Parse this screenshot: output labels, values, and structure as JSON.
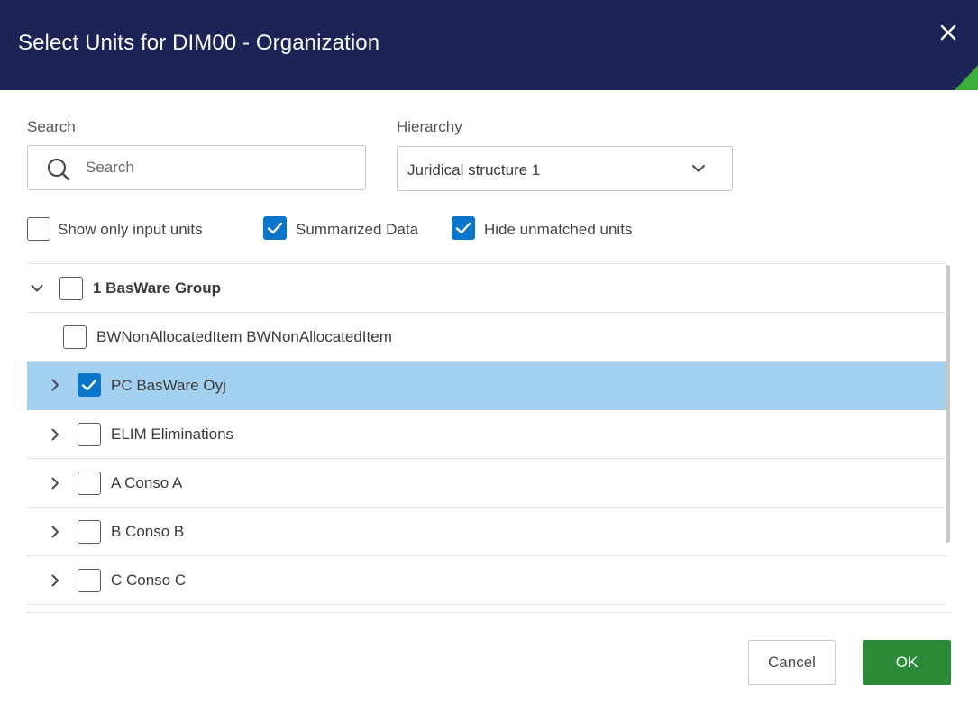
{
  "dialog": {
    "title": "Select Units for DIM00 - Organization",
    "colors": {
      "header_bg": "#1c2457",
      "accent": "#0a75c9",
      "selected_row": "#a3d0ef",
      "ok_button": "#2a8a38",
      "corner_mark": "#3cae3c"
    }
  },
  "search": {
    "label": "Search",
    "placeholder": "Search",
    "value": ""
  },
  "hierarchy": {
    "label": "Hierarchy",
    "selected": "Juridical structure 1"
  },
  "options": {
    "show_only_input_units": {
      "label": "Show only input units",
      "checked": false
    },
    "summarized_data": {
      "label": "Summarized Data",
      "checked": true
    },
    "hide_unmatched_units": {
      "label": "Hide unmatched units",
      "checked": true
    }
  },
  "tree": {
    "rows": [
      {
        "label": "1 BasWare Group",
        "expanded": true,
        "checked": false,
        "selected": false,
        "bold": true
      },
      {
        "label": "BWNonAllocatedItem BWNonAllocatedItem",
        "expanded": null,
        "checked": false,
        "selected": false,
        "bold": false
      },
      {
        "label": "PC BasWare Oyj",
        "expanded": false,
        "checked": true,
        "selected": true,
        "bold": false
      },
      {
        "label": "ELIM Eliminations",
        "expanded": false,
        "checked": false,
        "selected": false,
        "bold": false
      },
      {
        "label": "A Conso A",
        "expanded": false,
        "checked": false,
        "selected": false,
        "bold": false
      },
      {
        "label": "B Conso B",
        "expanded": false,
        "checked": false,
        "selected": false,
        "bold": false
      },
      {
        "label": "C Conso C",
        "expanded": false,
        "checked": false,
        "selected": false,
        "bold": false
      }
    ]
  },
  "buttons": {
    "cancel": "Cancel",
    "ok": "OK"
  },
  "icons": {
    "close": "close-icon",
    "search": "search-icon",
    "dropdown": "chevron-down-icon",
    "expand": "chevron-right-icon",
    "collapse": "chevron-down-icon",
    "check": "checkmark-icon"
  }
}
